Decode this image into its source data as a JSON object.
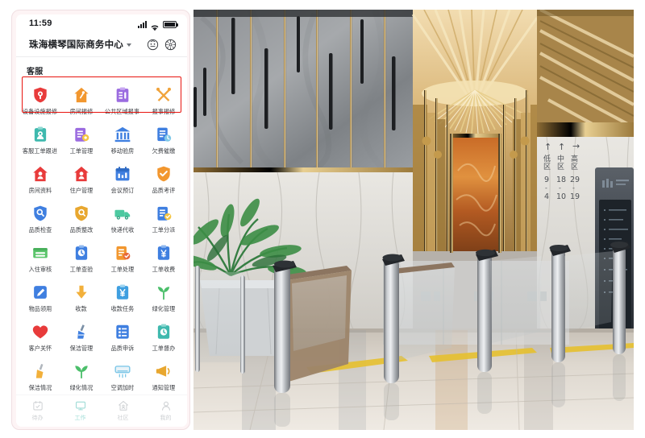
{
  "phone": {
    "status_bar": {
      "time": "11:59",
      "signal_icon": "signal-bars-icon",
      "wifi_icon": "wifi-icon",
      "battery_icon": "battery-full-icon"
    },
    "header": {
      "project_title": "珠海横琴国际商务中心",
      "dropdown_icon": "chevron-down-icon",
      "service_icon": "customer-face-icon",
      "settings_icon": "settings-flower-icon"
    },
    "section": {
      "title": "客服",
      "highlight_color": "#e8140f"
    },
    "grid": [
      {
        "label": "设备设施报修",
        "icon": "shield-alert-icon",
        "color": "#e83b3b"
      },
      {
        "label": "房间报修",
        "icon": "house-wrench-icon",
        "color": "#f2972f"
      },
      {
        "label": "公共区域报事",
        "icon": "clipboard-list-icon",
        "color": "#9b6ce0"
      },
      {
        "label": "报事报修",
        "icon": "crossed-tools-icon",
        "color": "#f0a33b"
      },
      {
        "label": "客服工单跟进",
        "icon": "clipboard-user-icon",
        "color": "#3fb9ae"
      },
      {
        "label": "工单管理",
        "icon": "clipboard-gear-icon",
        "color": "#9b6ce0"
      },
      {
        "label": "移动验房",
        "icon": "bank-building-icon",
        "color": "#3f7fe0"
      },
      {
        "label": "欠费催缴",
        "icon": "bill-overdue-icon",
        "color": "#3f7fe0"
      },
      {
        "label": "房间资料",
        "icon": "house-person-icon",
        "color": "#e83b3b"
      },
      {
        "label": "住户管理",
        "icon": "house-resident-icon",
        "color": "#e83b3b"
      },
      {
        "label": "会议预订",
        "icon": "calendar-meeting-icon",
        "color": "#3f7fe0"
      },
      {
        "label": "品质考评",
        "icon": "shield-check-icon",
        "color": "#f2972f"
      },
      {
        "label": "品质检查",
        "icon": "shield-search-icon",
        "color": "#3f7fe0"
      },
      {
        "label": "品质整改",
        "icon": "shield-edit-icon",
        "color": "#e8a72f"
      },
      {
        "label": "快递代收",
        "icon": "delivery-truck-icon",
        "color": "#4cc9a0"
      },
      {
        "label": "工单分派",
        "icon": "clipboard-assign-icon",
        "color": "#3f7fe0"
      },
      {
        "label": "入住审核",
        "icon": "checkin-desk-icon",
        "color": "#5bc56b"
      },
      {
        "label": "工单查验",
        "icon": "clipboard-check-icon",
        "color": "#3f7fe0"
      },
      {
        "label": "工单处理",
        "icon": "clipboard-done-icon",
        "color": "#f2972f"
      },
      {
        "label": "工单收费",
        "icon": "clipboard-yuan-icon",
        "color": "#3f7fe0"
      },
      {
        "label": "物品领用",
        "icon": "pen-square-icon",
        "color": "#3f7fe0"
      },
      {
        "label": "收款",
        "icon": "down-arrow-icon",
        "color": "#f2b03b"
      },
      {
        "label": "收款任务",
        "icon": "yuan-task-icon",
        "color": "#3f9fe0"
      },
      {
        "label": "绿化管理",
        "icon": "plant-leaf-icon",
        "color": "#4cbf6b"
      },
      {
        "label": "客户关怀",
        "icon": "heart-icon",
        "color": "#e83b3b"
      },
      {
        "label": "保洁管理",
        "icon": "broom-icon",
        "color": "#3f7fe0"
      },
      {
        "label": "品质申诉",
        "icon": "list-appeal-icon",
        "color": "#3f7fe0"
      },
      {
        "label": "工单督办",
        "icon": "clipboard-watch-icon",
        "color": "#3fb9ae"
      },
      {
        "label": "保洁情况",
        "icon": "mop-icon",
        "color": "#f2b03b"
      },
      {
        "label": "绿化情况",
        "icon": "leaf-pair-icon",
        "color": "#4cbf6b"
      },
      {
        "label": "空调加时",
        "icon": "air-conditioner-icon",
        "color": "#7fc8e8"
      },
      {
        "label": "通知管理",
        "icon": "megaphone-icon",
        "color": "#e8a72f"
      }
    ],
    "tabbar": [
      {
        "label": "待办",
        "icon": "calendar-todo-icon",
        "active": false
      },
      {
        "label": "工作",
        "icon": "monitor-work-icon",
        "active": true
      },
      {
        "label": "社区",
        "icon": "community-home-icon",
        "active": false
      },
      {
        "label": "我的",
        "icon": "user-profile-icon",
        "active": false
      }
    ]
  },
  "photo": {
    "description": "office-lobby-photo",
    "directory_sign": {
      "zones": [
        {
          "arrow": "↑",
          "name": "低区",
          "range_top": "9",
          "range_bottom": "4"
        },
        {
          "arrow": "↑",
          "name": "中区",
          "range_top": "18",
          "range_bottom": "10"
        },
        {
          "arrow": "→",
          "name": "高区",
          "range_top": "29",
          "range_bottom": "19"
        }
      ]
    },
    "elements": {
      "turnstiles": "speed-gate-turnstiles",
      "plant": "potted-palm-plant",
      "display_panel": "digital-directory-panel",
      "ceiling_light": "gold-chandelier",
      "artwork": "amber-wall-artwork"
    }
  }
}
